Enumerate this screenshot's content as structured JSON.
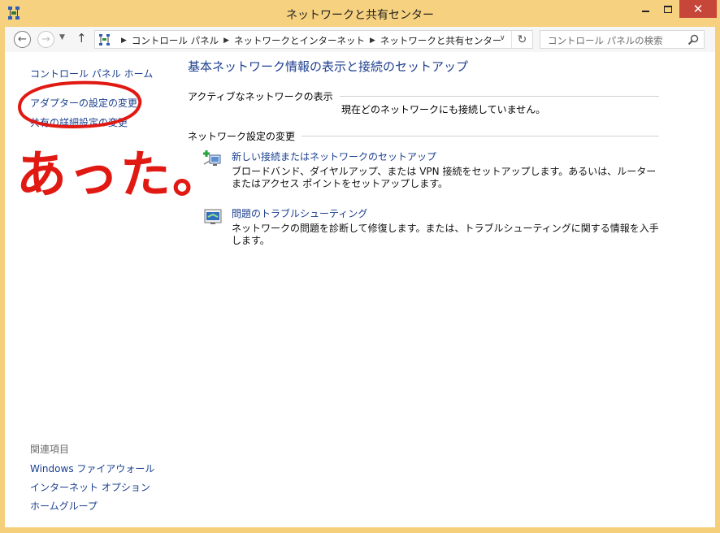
{
  "window": {
    "title": "ネットワークと共有センター"
  },
  "address": {
    "crumbs": [
      "コントロール パネル",
      "ネットワークとインターネット",
      "ネットワークと共有センター"
    ]
  },
  "search": {
    "placeholder": "コントロール パネルの検索"
  },
  "sidebar": {
    "home": "コントロール パネル ホーム",
    "adapter": "アダプターの設定の変更",
    "sharing": "共有の詳細設定の変更",
    "related_heading": "関連項目",
    "related": [
      "Windows ファイアウォール",
      "インターネット オプション",
      "ホームグループ"
    ]
  },
  "main": {
    "title": "基本ネットワーク情報の表示と接続のセットアップ",
    "active_label": "アクティブなネットワークの表示",
    "no_connection": "現在どのネットワークにも接続していません。",
    "settings_label": "ネットワーク設定の変更",
    "tasks": [
      {
        "link": "新しい接続またはネットワークのセットアップ",
        "desc": "ブロードバンド、ダイヤルアップ、または VPN 接続をセットアップします。あるいは、ルーターまたはアクセス ポイントをセットアップします。"
      },
      {
        "link": "問題のトラブルシューティング",
        "desc": "ネットワークの問題を診断して修復します。または、トラブルシューティングに関する情報を入手します。"
      }
    ]
  },
  "annotation": {
    "text": "あった。"
  },
  "colors": {
    "titlebar": "#f6d17f",
    "link": "#1a3f8f",
    "close": "#c7463a",
    "annotation": "#e11913"
  }
}
